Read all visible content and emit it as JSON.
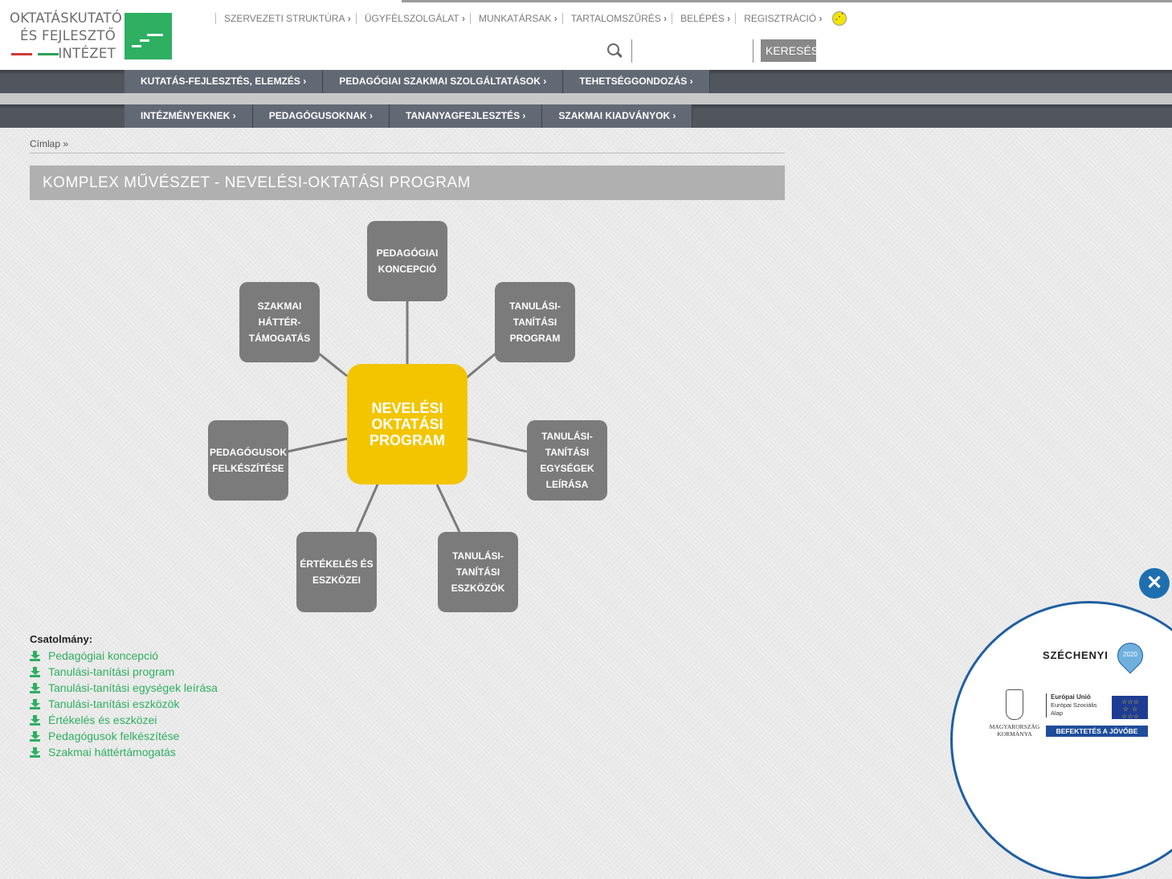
{
  "logo": {
    "line1": "OKTATÁSKUTATÓ",
    "line2": "ÉS FEJLESZTŐ",
    "line3": "INTÉZET"
  },
  "top_nav": [
    "SZERVEZETI STRUKTÚRA",
    "ÜGYFÉLSZOLGÁLAT",
    "MUNKATÁRSAK",
    "TARTALOMSZŰRÉS",
    "BELÉPÉS",
    "REGISZTRÁCIÓ"
  ],
  "search": {
    "placeholder": "",
    "button_label": "KERESÉS"
  },
  "main_nav_1": [
    "KUTATÁS-FEJLESZTÉS, ELEMZÉS",
    "PEDAGÓGIAI SZAKMAI SZOLGÁLTATÁSOK",
    "TEHETSÉGGONDOZÁS"
  ],
  "main_nav_2": [
    "INTÉZMÉNYEKNEK",
    "PEDAGÓGUSOKNAK",
    "TANANYAGFEJLESZTÉS",
    "SZAKMAI KIADVÁNYOK"
  ],
  "breadcrumb": "Címlap »",
  "page_title": "KOMPLEX MŰVÉSZET - NEVELÉSI-OKTATÁSI PROGRAM",
  "diagram": {
    "center": [
      "NEVELÉSI",
      "OKTATÁSI",
      "PROGRAM"
    ],
    "nodes": [
      [
        "PEDAGÓGIAI",
        "KONCEPCIÓ"
      ],
      [
        "TANULÁSI-",
        "TANÍTÁSI",
        "PROGRAM"
      ],
      [
        "TANULÁSI-",
        "TANÍTÁSI",
        "EGYSÉGEK",
        "LEÍRÁSA"
      ],
      [
        "TANULÁSI-",
        "TANÍTÁSI",
        "ESZKÖZÖK"
      ],
      [
        "ÉRTÉKELÉS ÉS",
        "ESZKÖZEI"
      ],
      [
        "PEDAGÓGUSOK",
        "FELKÉSZÍTÉSE"
      ],
      [
        "SZAKMAI",
        "HÁTTÉR-",
        "TÁMOGATÁS"
      ]
    ]
  },
  "attachments": {
    "label": "Csatolmány:",
    "items": [
      "Pedagógiai koncepció",
      "Tanulási-tanítási program",
      "Tanulási-tanítási egységek leírása",
      "Tanulási-tanítási eszközök",
      "Értékelés és eszközei",
      "Pedagógusok felkészítése",
      "Szakmai háttértámogatás"
    ]
  },
  "badge": {
    "szechenyi": "SZÉCHENYI",
    "pin_label": "2020",
    "gov": [
      "MAGYARORSZÁG",
      "KORMÁNYA"
    ],
    "eu": [
      "Európai Unió",
      "Európai Szociális",
      "Alap"
    ],
    "bar": "BEFEKTETÉS A JÖVŐBE"
  },
  "colors": {
    "green": "#2eaf62",
    "yellow": "#f2c500",
    "node_gray": "#7b7b7b",
    "nav_dark": "#50555e",
    "badge_blue": "#1f5fa0"
  }
}
